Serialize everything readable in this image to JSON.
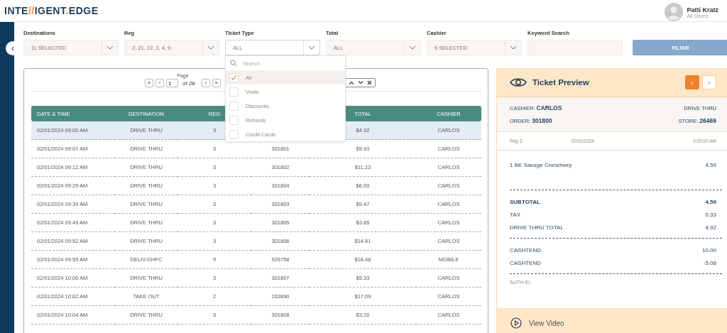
{
  "header": {
    "logo": [
      {
        "text": "INTE",
        "accent": false
      },
      {
        "text": "//",
        "accent": true
      },
      {
        "text": "IGENT",
        "accent": false
      },
      {
        "text": ".",
        "accent": true
      },
      {
        "text": "EDGE",
        "accent": false
      }
    ],
    "user": {
      "name": "Patti Kratz",
      "scope": "All Stores"
    }
  },
  "sidebar": {
    "toggle": "‹"
  },
  "filters": [
    {
      "label": "Destinations",
      "kind": "select",
      "value": "11 SELECTED",
      "expanded": false
    },
    {
      "label": "Reg",
      "kind": "select",
      "value": "2, 21, 22, 3, 4, 9",
      "expanded": false
    },
    {
      "label": "Ticket Type",
      "kind": "select",
      "value": "ALL",
      "expanded": true,
      "search_placeholder": "Search",
      "options": [
        {
          "label": "All",
          "checked": true
        },
        {
          "label": "Voids",
          "checked": false
        },
        {
          "label": "Discounts",
          "checked": false
        },
        {
          "label": "Refunds",
          "checked": false
        },
        {
          "label": "Credit Cards",
          "checked": false
        }
      ]
    },
    {
      "label": "Total",
      "kind": "select",
      "value": "ALL",
      "expanded": false
    },
    {
      "label": "Cashier",
      "kind": "select",
      "value": "6 SELECTED",
      "expanded": false
    },
    {
      "label": "Keyword Search",
      "kind": "text"
    }
  ],
  "filter_button": "FILTER",
  "pager": {
    "label": "Page",
    "first": "«",
    "prev": "‹",
    "page": "1",
    "total": "of 28",
    "next": "›",
    "last": "»"
  },
  "table": {
    "columns": [
      {
        "label": "DATE & TIME"
      },
      {
        "label": "DESTINATION"
      },
      {
        "label": "REG"
      },
      {},
      {
        "label": "TOTAL"
      },
      {
        "label": "CASHIER"
      }
    ],
    "rows": [
      {
        "selected": true,
        "cells": [
          "02/01/2024 09:00 AM",
          "DRIVE THRU",
          "3",
          null,
          "$4.92",
          "CARLOS"
        ]
      },
      {
        "selected": false,
        "cells": [
          "02/01/2024 09:07 AM",
          "DRIVE THRU",
          "3",
          "301801",
          "$9.93",
          "CARLOS"
        ]
      },
      {
        "selected": false,
        "cells": [
          "02/01/2024 09:12 AM",
          "DRIVE THRU",
          "3",
          "301802",
          "$11.23",
          "CARLOS"
        ]
      },
      {
        "selected": false,
        "cells": [
          "02/01/2024 09:29 AM",
          "DRIVE THRU",
          "3",
          "301804",
          "$6.00",
          "CARLOS"
        ]
      },
      {
        "selected": false,
        "cells": [
          "02/01/2024 09:39 AM",
          "DRIVE THRU",
          "3",
          "301803",
          "$9.47",
          "CARLOS"
        ]
      },
      {
        "selected": false,
        "cells": [
          "02/01/2024 09:49 AM",
          "DRIVE THRU",
          "3",
          "301805",
          "$3.85",
          "CARLOS"
        ]
      },
      {
        "selected": false,
        "cells": [
          "02/01/2024 09:52 AM",
          "DRIVE THRU",
          "3",
          "301806",
          "$14.81",
          "CARLOS"
        ]
      },
      {
        "selected": false,
        "cells": [
          "02/01/2024 09:59 AM",
          "DELIV-GHFC",
          "9",
          "929758",
          "$18.48",
          "MOBILE"
        ]
      },
      {
        "selected": false,
        "cells": [
          "02/01/2024 10:00 AM",
          "DRIVE THRU",
          "3",
          "301807",
          "$5.33",
          "CARLOS"
        ]
      },
      {
        "selected": false,
        "cells": [
          "02/01/2024 10:02 AM",
          "TAKE OUT",
          "2",
          "263890",
          "$17.09",
          "CARLOS"
        ]
      },
      {
        "selected": false,
        "cells": [
          "02/01/2024 10:04 AM",
          "DRIVE THRU",
          "3",
          "301808",
          "$3.20",
          "CARLOS"
        ]
      }
    ]
  },
  "preview": {
    "title": "Ticket Preview",
    "nav": [
      {
        "glyph": "‹",
        "highlighted": true
      },
      {
        "glyph": "›",
        "highlighted": false
      }
    ],
    "info": [
      [
        "CASHIER: **CARLOS**",
        "DRIVE THRU"
      ],
      [
        "ORDER: **301800**",
        "STORE: **26469**"
      ]
    ],
    "meta": [
      "Reg 3",
      "02/01/2024",
      "9:00:00 AM"
    ],
    "items": [
      {
        "name": "1 BK Sausge Crunchwrp",
        "amount": "4.59"
      }
    ],
    "groups": [
      [
        {
          "label": "SUBTOTAL",
          "amount": "4.59",
          "emphasis": true
        },
        {
          "label": "TAX",
          "amount": "0.33",
          "emphasis": false
        },
        {
          "label": "DRIVE THRU TOTAL",
          "amount": "4.92",
          "emphasis": false
        }
      ],
      [
        {
          "label": "CASHTEND",
          "amount": "10.00",
          "emphasis": false
        },
        {
          "label": "CASHTEND",
          "amount": "-5.08",
          "emphasis": false
        }
      ]
    ],
    "auth": "AUTH ID:",
    "footer": "View Video"
  }
}
